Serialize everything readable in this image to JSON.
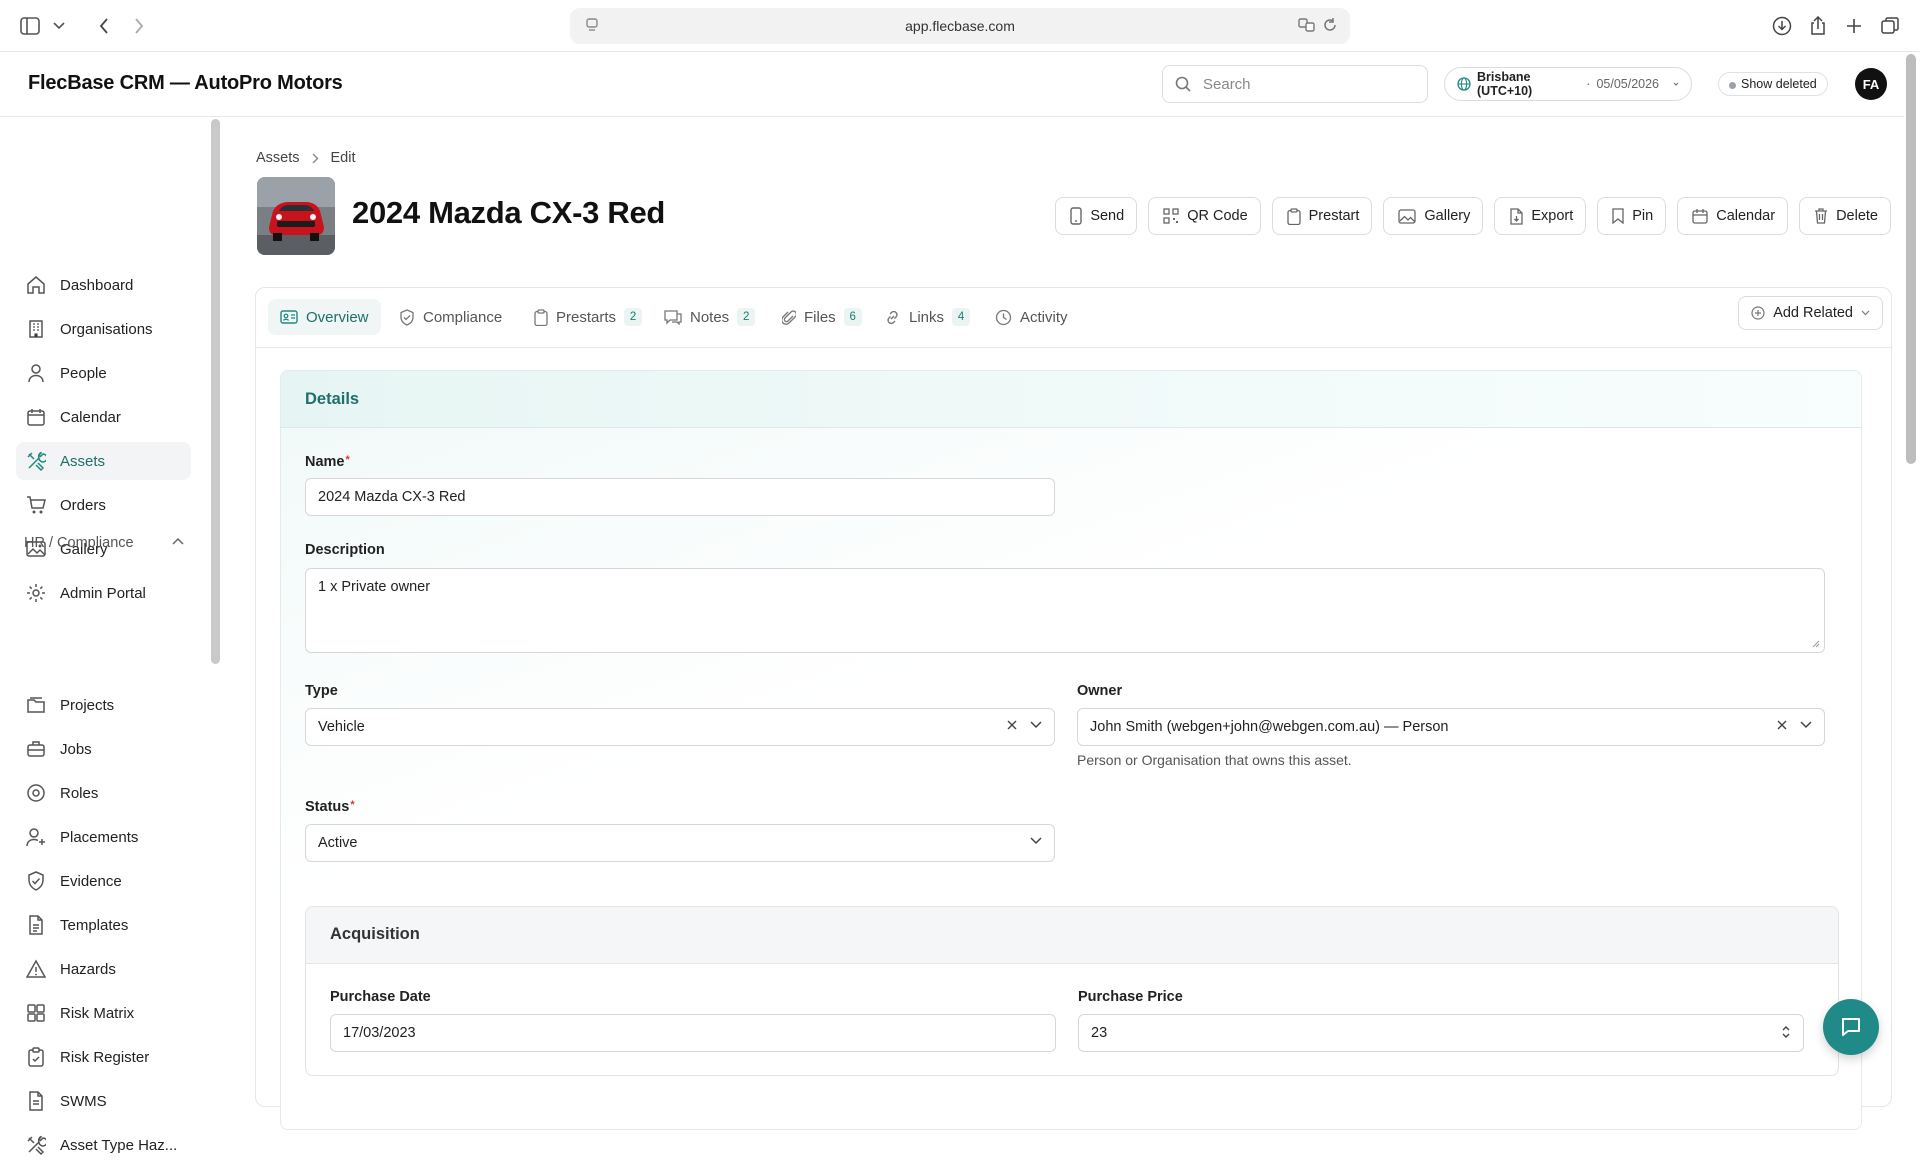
{
  "browser": {
    "url": "app.flecbase.com"
  },
  "app": {
    "brand": "FlecBase CRM — AutoPro Motors",
    "search_placeholder": "Search",
    "timezone": "Brisbane (UTC+10)",
    "date": "05/05/2026",
    "show_deleted": "Show deleted",
    "avatar_initials": "FA",
    "accent_color": "#1f8a7f"
  },
  "sidebar": {
    "items": [
      {
        "label": "Dashboard",
        "icon": "home-icon"
      },
      {
        "label": "Organisations",
        "icon": "building-icon"
      },
      {
        "label": "People",
        "icon": "person-icon"
      },
      {
        "label": "Calendar",
        "icon": "calendar-icon"
      },
      {
        "label": "Assets",
        "icon": "tools-icon",
        "active": true
      },
      {
        "label": "Orders",
        "icon": "cart-icon"
      },
      {
        "label": "Gallery",
        "icon": "image-icon"
      },
      {
        "label": "Admin Portal",
        "icon": "gear-icon"
      }
    ],
    "section_label": "HR / Compliance",
    "section_items": [
      {
        "label": "Projects",
        "icon": "folder-icon"
      },
      {
        "label": "Jobs",
        "icon": "briefcase-icon"
      },
      {
        "label": "Roles",
        "icon": "target-icon"
      },
      {
        "label": "Placements",
        "icon": "person-plus-icon"
      },
      {
        "label": "Evidence",
        "icon": "shield-check-icon"
      },
      {
        "label": "Templates",
        "icon": "document-icon"
      },
      {
        "label": "Hazards",
        "icon": "warning-icon"
      },
      {
        "label": "Risk Matrix",
        "icon": "grid-icon"
      },
      {
        "label": "Risk Register",
        "icon": "clipboard-icon"
      },
      {
        "label": "SWMS",
        "icon": "document-icon"
      },
      {
        "label": "Asset Type Haz...",
        "icon": "tools-icon"
      }
    ]
  },
  "breadcrumb": {
    "parent": "Assets",
    "current": "Edit"
  },
  "page": {
    "title": "2024 Mazda CX-3 Red"
  },
  "actions": [
    "Send",
    "QR Code",
    "Prestart",
    "Gallery",
    "Export",
    "Pin",
    "Calendar",
    "Delete"
  ],
  "tabs": [
    {
      "label": "Overview",
      "active": true
    },
    {
      "label": "Compliance"
    },
    {
      "label": "Prestarts",
      "count": "2"
    },
    {
      "label": "Notes",
      "count": "2"
    },
    {
      "label": "Files",
      "count": "6"
    },
    {
      "label": "Links",
      "count": "4"
    },
    {
      "label": "Activity"
    }
  ],
  "add_related": "Add Related",
  "details": {
    "title": "Details",
    "name_label": "Name",
    "name_value": "2024 Mazda CX-3 Red",
    "description_label": "Description",
    "description_value": "1 x Private owner",
    "type_label": "Type",
    "type_value": "Vehicle",
    "owner_label": "Owner",
    "owner_value": "John Smith (webgen+john@webgen.com.au) — Person",
    "owner_hint": "Person or Organisation that owns this asset.",
    "status_label": "Status",
    "status_value": "Active"
  },
  "acquisition": {
    "title": "Acquisition",
    "purchase_date_label": "Purchase Date",
    "purchase_date_value": "17/03/2023",
    "purchase_price_label": "Purchase Price",
    "purchase_price_value": "23"
  }
}
